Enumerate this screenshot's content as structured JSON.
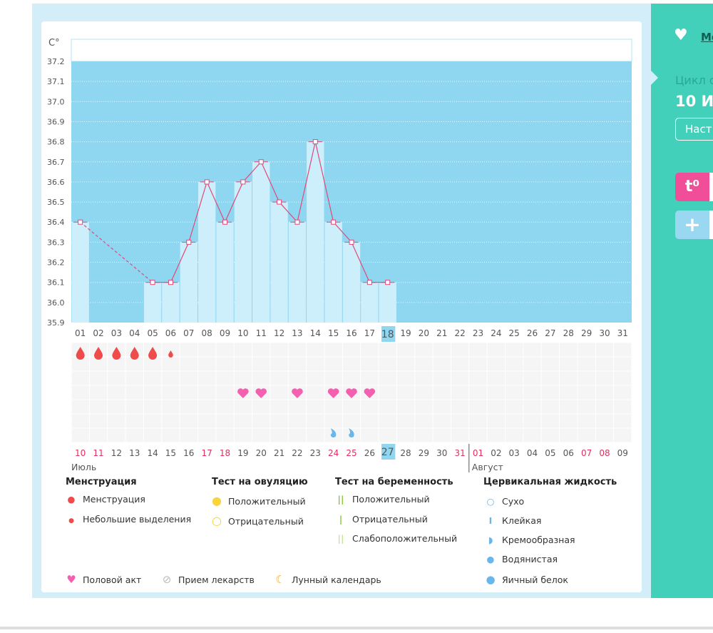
{
  "chart_data": {
    "type": "bar",
    "ylabel": "C°",
    "ylim": [
      35.9,
      37.2
    ],
    "yticks": [
      "37.2",
      "37.1",
      "37.0",
      "36.9",
      "36.8",
      "36.7",
      "36.6",
      "36.5",
      "36.4",
      "36.3",
      "36.2",
      "36.1",
      "36.0",
      "35.9"
    ],
    "cycle_days": [
      "01",
      "02",
      "03",
      "04",
      "05",
      "06",
      "07",
      "08",
      "09",
      "10",
      "11",
      "12",
      "13",
      "14",
      "15",
      "16",
      "17",
      "18",
      "19",
      "20",
      "21",
      "22",
      "23",
      "24",
      "25",
      "26",
      "27",
      "28",
      "29",
      "30",
      "31"
    ],
    "current_day": "18",
    "temperatures": [
      36.4,
      null,
      null,
      null,
      36.1,
      36.1,
      36.3,
      36.6,
      36.4,
      36.6,
      36.7,
      36.5,
      36.4,
      36.8,
      36.4,
      36.3,
      36.1,
      36.1
    ],
    "dates": [
      "10",
      "11",
      "12",
      "13",
      "14",
      "15",
      "16",
      "17",
      "18",
      "19",
      "20",
      "21",
      "22",
      "23",
      "24",
      "25",
      "26",
      "27",
      "28",
      "29",
      "30",
      "31",
      "01",
      "02",
      "03",
      "04",
      "05",
      "06",
      "07",
      "08",
      "09"
    ],
    "weekend_dates_idx": [
      0,
      1,
      7,
      8,
      14,
      15,
      21,
      22,
      28,
      29
    ],
    "current_date": "27",
    "months": [
      "Июль",
      "Август"
    ],
    "menstruation": [
      "full",
      "full",
      "full",
      "full",
      "full",
      "light"
    ],
    "intercourse_days": [
      10,
      11,
      13,
      15,
      16,
      17
    ],
    "cervical_creamy_days": [
      15,
      16
    ]
  },
  "colors": {
    "bar_bg": "#8fd6f1",
    "bar": "#cdeefb",
    "line": "#e0497a",
    "menstruation": "#f04b4b",
    "heart": "#f55fb0",
    "fluid": "#69b6ea",
    "teal": "#43d0bb",
    "pink": "#f04e98",
    "ovulation": "#f9d43a",
    "pregnancy": "#8cc63f"
  },
  "legend": {
    "menstruation": {
      "title": "Менструация",
      "items": [
        "Менструация",
        "Небольшие выделения"
      ]
    },
    "ovulation": {
      "title": "Тест на овуляцию",
      "items": [
        "Положительный",
        "Отрицательный"
      ]
    },
    "pregnancy": {
      "title": "Тест на беременность",
      "items": [
        "Положительный",
        "Отрицательный",
        "Слабоположительный"
      ]
    },
    "cervical": {
      "title": "Цервикальная жидкость",
      "items": [
        "Сухо",
        "Клейкая",
        "Кремообразная",
        "Водянистая",
        "Яичный белок"
      ]
    },
    "bottom": [
      "Половой акт",
      "Прием лекарств",
      "Лунный календарь"
    ]
  },
  "sidebar": {
    "link": "Мо",
    "cycle_label": "Цикл с",
    "cycle_date": "10 И",
    "settings": "Наст",
    "temp_btn": "t⁰",
    "add_btn": "+"
  }
}
